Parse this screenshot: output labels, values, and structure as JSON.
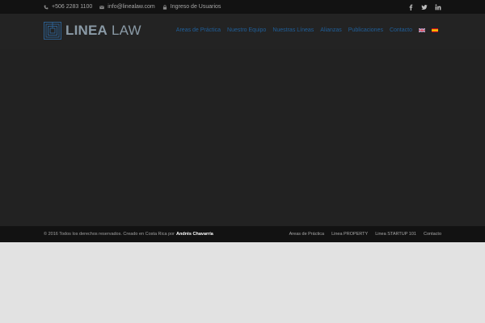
{
  "topbar": {
    "phone": "+506 2283 1100",
    "email": "info@linealaw.com",
    "login": "Ingreso de Usuarios",
    "icons": [
      "phone-icon",
      "envelope-icon",
      "lock-icon"
    ],
    "social": [
      "facebook-icon",
      "twitter-icon",
      "linkedin-icon"
    ]
  },
  "logo": {
    "bold": "LINEA",
    "light": "LAW"
  },
  "nav": {
    "items": [
      "Areas de Práctica",
      "Nuestro Equipo",
      "Nuestras Líneas",
      "Alianzas",
      "Publicaciones",
      "Contacto"
    ],
    "languages": [
      "English",
      "Español"
    ]
  },
  "footer": {
    "copyright": "© 2016 Todos los derechos reservados. Creado en Costa Rica por",
    "author": "Andrés Chavarría",
    "links": [
      "Areas de Práctica",
      "Linea PROPERTY",
      "Linea STARTUP 101",
      "Contacto"
    ]
  },
  "colors": {
    "topbar_bg": "#121212",
    "header_bg": "#232323",
    "content_bg": "#222222",
    "nav_link": "#1f5f9a",
    "logo": "#8a9aa6",
    "page_bg": "#e2e2e2"
  }
}
